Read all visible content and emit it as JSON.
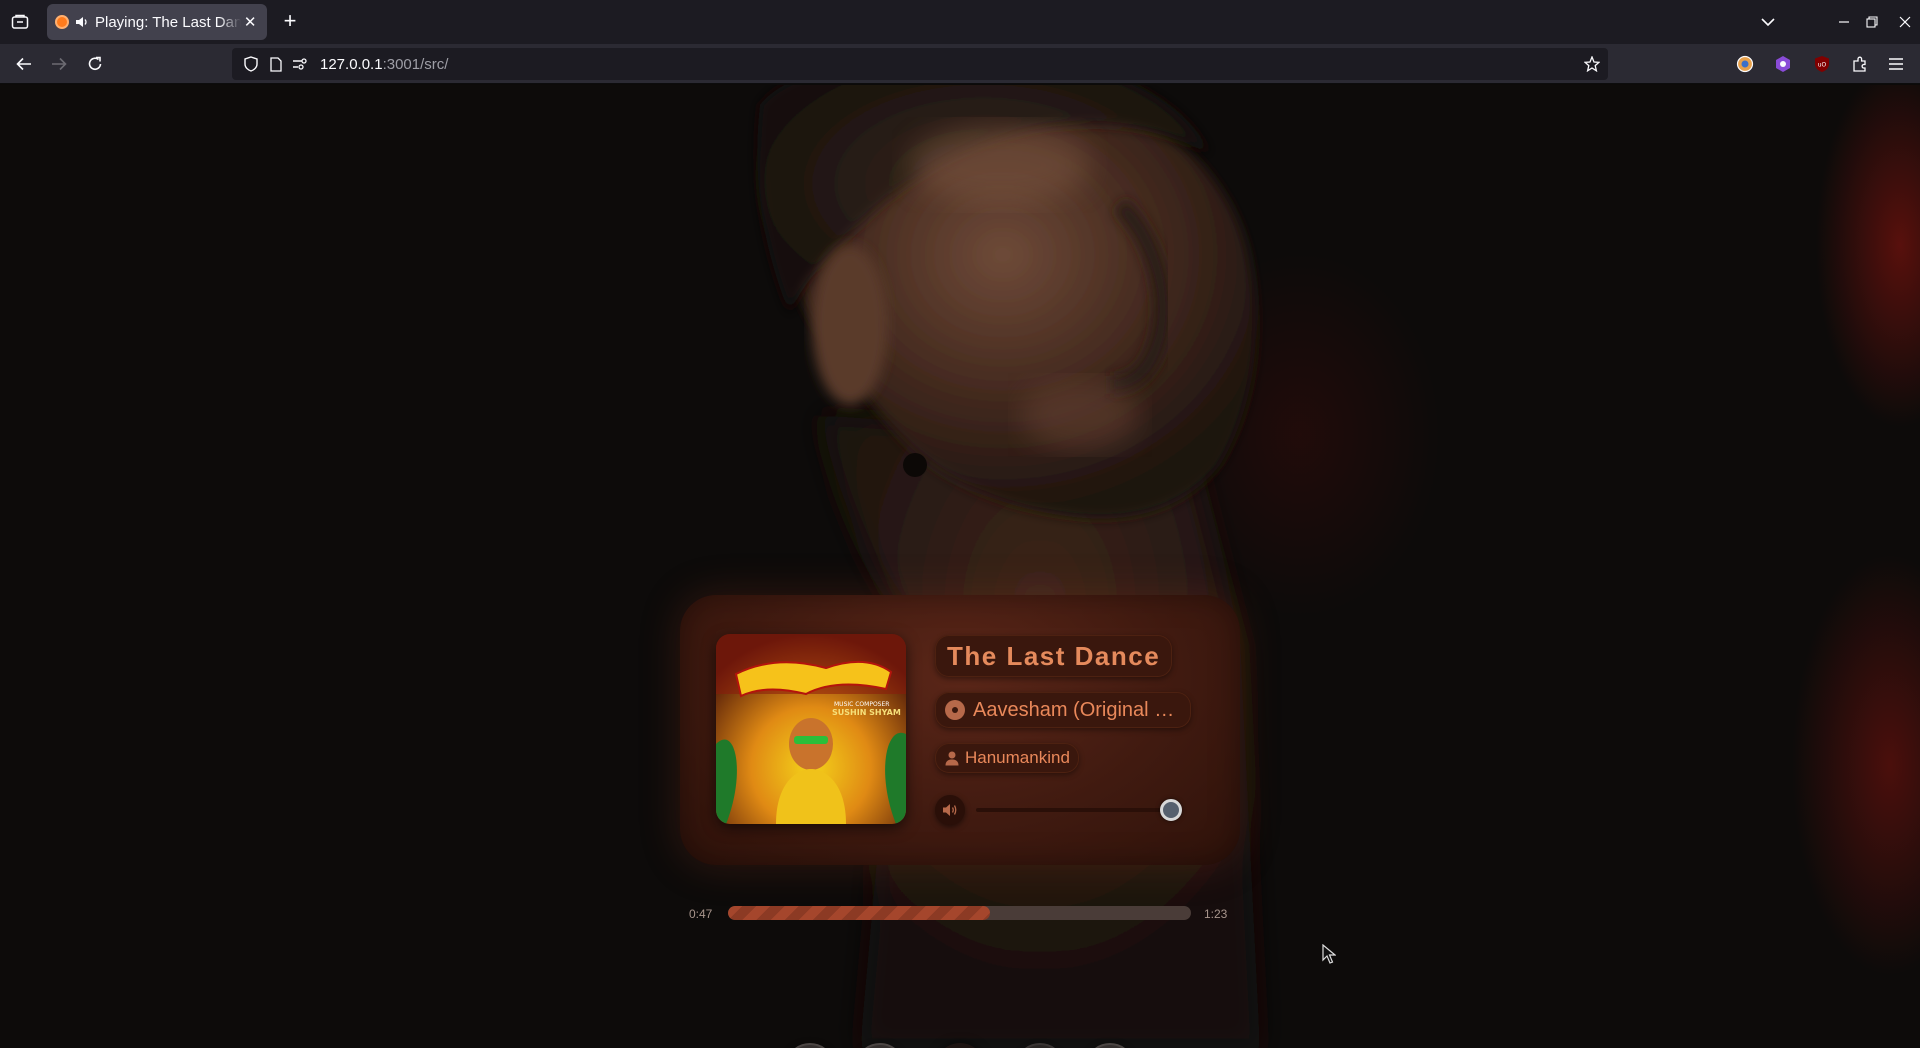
{
  "browser": {
    "tab_title": "Playing: The Last Dance",
    "url_host": "127.0.0.1",
    "url_rest": ":3001/src/"
  },
  "player": {
    "track_title": "The Last Dance",
    "album": "Aavesham (Original M...",
    "artist": "Hanumankind",
    "volume": 1.0,
    "elapsed": "0:47",
    "duration": "1:23",
    "progress": 0.566,
    "album_art": {
      "label_top": "MUSIC COMPOSER",
      "label_name": "SUSHIN SHYAM"
    }
  },
  "controls": [
    "replay-icon",
    "previous-icon",
    "pause-icon",
    "next-icon",
    "playlist-icon"
  ],
  "colors": {
    "accent": "#e58a5c",
    "card": "#401a10",
    "progress_fill": "#a5462c"
  }
}
